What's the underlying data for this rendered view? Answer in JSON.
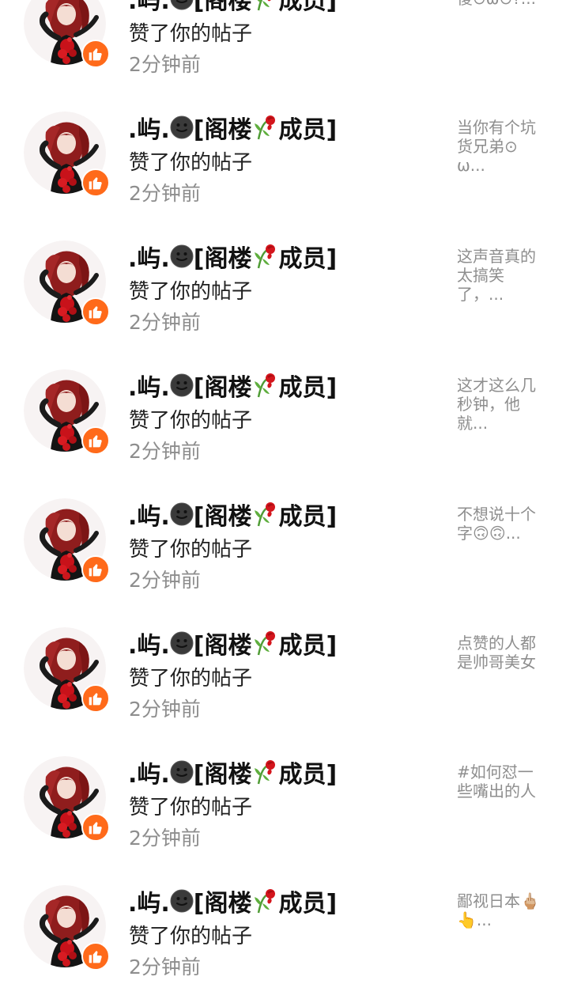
{
  "colors": {
    "like_badge": "#ff6a1a",
    "name": "#111111",
    "meta": "#8e8e8e"
  },
  "icons": {
    "face": "dark-smiley-icon",
    "flower": "wilted-rose-icon",
    "badge": "thumbs-up-icon"
  },
  "notifications": [
    {
      "name_prefix": ".屿.",
      "name_mid": "[阁楼",
      "name_suffix": "成员]",
      "action": "赞了你的帖子",
      "time": "2分钟前",
      "excerpt": "傻⊙ω⊙?..."
    },
    {
      "name_prefix": ".屿.",
      "name_mid": "[阁楼",
      "name_suffix": "成员]",
      "action": "赞了你的帖子",
      "time": "2分钟前",
      "excerpt": "当你有个坑货兄弟⊙ω..."
    },
    {
      "name_prefix": ".屿.",
      "name_mid": "[阁楼",
      "name_suffix": "成员]",
      "action": "赞了你的帖子",
      "time": "2分钟前",
      "excerpt": "这声音真的太搞笑了，..."
    },
    {
      "name_prefix": ".屿.",
      "name_mid": "[阁楼",
      "name_suffix": "成员]",
      "action": "赞了你的帖子",
      "time": "2分钟前",
      "excerpt": "这才这么几秒钟，他就..."
    },
    {
      "name_prefix": ".屿.",
      "name_mid": "[阁楼",
      "name_suffix": "成员]",
      "action": "赞了你的帖子",
      "time": "2分钟前",
      "excerpt": "不想说十个字🙃🙃..."
    },
    {
      "name_prefix": ".屿.",
      "name_mid": "[阁楼",
      "name_suffix": "成员]",
      "action": "赞了你的帖子",
      "time": "2分钟前",
      "excerpt": "点赞的人都是帅哥美女"
    },
    {
      "name_prefix": ".屿.",
      "name_mid": "[阁楼",
      "name_suffix": "成员]",
      "action": "赞了你的帖子",
      "time": "2分钟前",
      "excerpt": "#如何怼一些嘴出的人"
    },
    {
      "name_prefix": ".屿.",
      "name_mid": "[阁楼",
      "name_suffix": "成员]",
      "action": "赞了你的帖子",
      "time": "2分钟前",
      "excerpt": "鄙视日本🖕🏼👆..."
    }
  ]
}
